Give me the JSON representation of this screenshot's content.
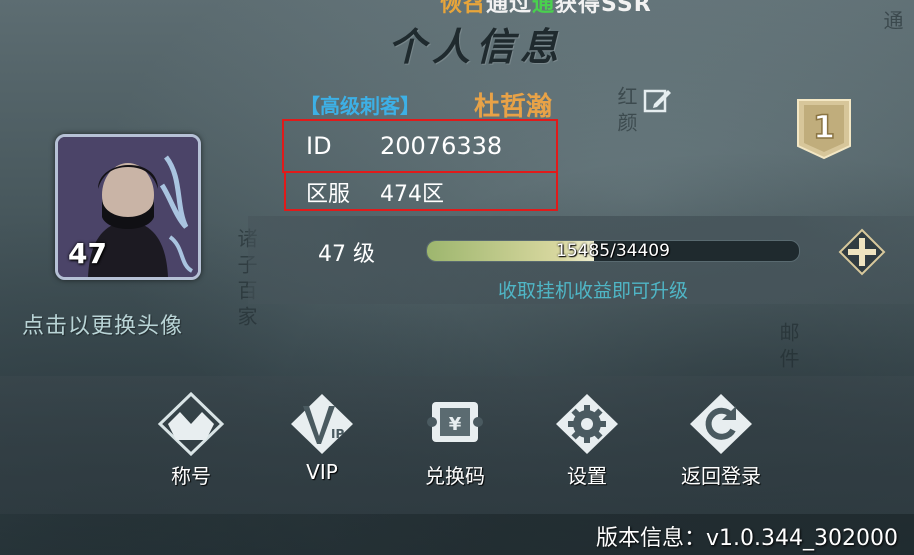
{
  "banner": {
    "part1": "恢召",
    "part2": "通过",
    "part3": "通",
    "part4": "获得SSR"
  },
  "title": "个人信息",
  "deco": {
    "side_left": "诸子百家",
    "side_mid": "红颜",
    "side_right": "邮件",
    "top_right": "通"
  },
  "avatar": {
    "level": "47",
    "caption": "点击以更换头像"
  },
  "profile": {
    "rank_tag": "【高级刺客】",
    "name": "杜哲瀚",
    "id_label": "ID",
    "id_value": "20076338",
    "server_label": "区服",
    "server_value": "474区",
    "badge_number": "1"
  },
  "exp": {
    "level_label": "47 级",
    "text": "15485/34409",
    "current": 15485,
    "max": 34409,
    "hint": "收取挂机收益即可升级"
  },
  "actions": [
    {
      "label": "称号",
      "icon": "crown-icon"
    },
    {
      "label": "VIP",
      "icon": "vip-icon"
    },
    {
      "label": "兑换码",
      "icon": "ticket-icon"
    },
    {
      "label": "设置",
      "icon": "gear-icon"
    },
    {
      "label": "返回登录",
      "icon": "return-icon"
    }
  ],
  "version": "版本信息：v1.0.344_302000",
  "colors": {
    "accent_gold": "#e8a247",
    "rank_blue": "#3db0e6",
    "hint_teal": "#4fb6c6",
    "highlight_red": "#e11a1a"
  }
}
